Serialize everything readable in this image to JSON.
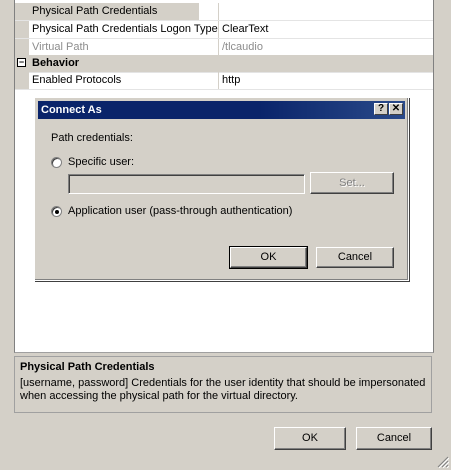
{
  "grid": {
    "rows": [
      {
        "name": "Physical Path Credentials",
        "value": "",
        "style": "sel"
      },
      {
        "name": "Physical Path Credentials Logon Type",
        "value": "ClearText",
        "style": ""
      },
      {
        "name": "Virtual Path",
        "value": "/tlcaudio",
        "style": "gray"
      }
    ],
    "category": {
      "name": "Behavior",
      "expander": "⊟"
    },
    "rows2": [
      {
        "name": "Enabled Protocols",
        "value": "http"
      }
    ]
  },
  "dialog": {
    "title": "Connect As",
    "help_label": "?",
    "close_label": "✕",
    "section_label": "Path credentials:",
    "specific_user_label": "Specific user:",
    "specific_user_value": "",
    "set_label": "Set...",
    "app_user_label": "Application user (pass-through authentication)",
    "ok_label": "OK",
    "cancel_label": "Cancel",
    "selected": "application_user"
  },
  "description": {
    "title": "Physical Path Credentials",
    "text": "[username, password] Credentials for the user identity that should be impersonated when accessing the physical path for the virtual directory."
  },
  "footer": {
    "ok_label": "OK",
    "cancel_label": "Cancel"
  }
}
